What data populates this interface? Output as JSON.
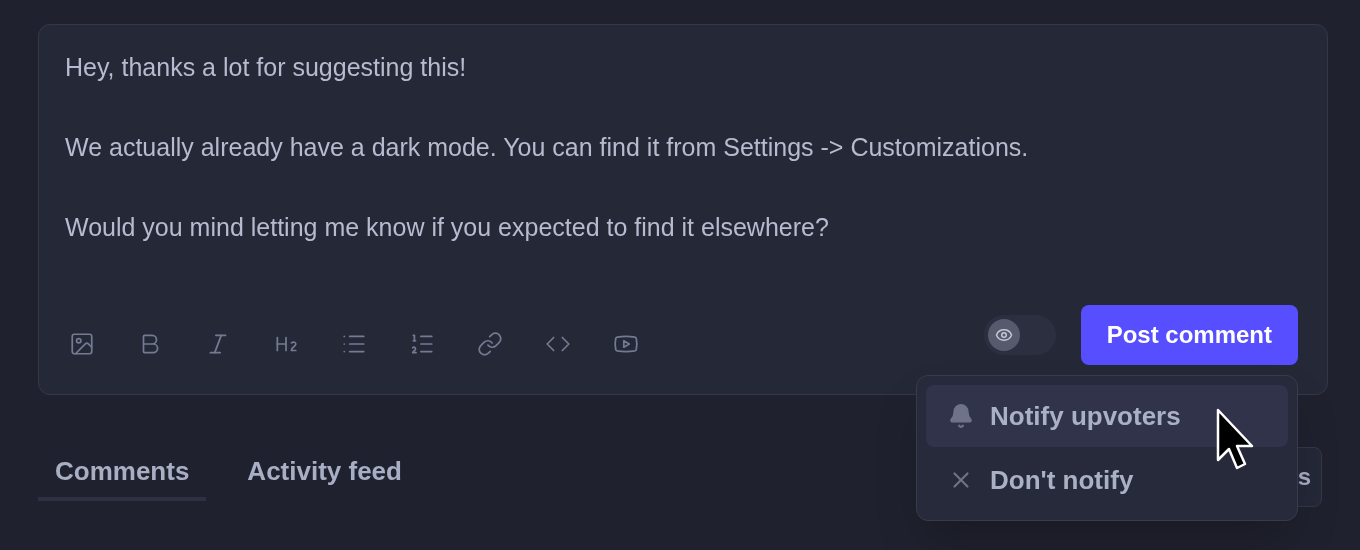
{
  "editor": {
    "paragraphs": [
      "Hey, thanks a lot for suggesting this!",
      "We actually already have a dark mode. You can find it from Settings -> Customizations.",
      "Would you mind letting me know if you expected to find it elsewhere?"
    ],
    "toolbar": [
      {
        "kind": "image"
      },
      {
        "kind": "bold"
      },
      {
        "kind": "italic"
      },
      {
        "kind": "heading"
      },
      {
        "kind": "bullets"
      },
      {
        "kind": "numbers"
      },
      {
        "kind": "link"
      },
      {
        "kind": "code"
      },
      {
        "kind": "video"
      }
    ],
    "private_toggle": {
      "on": false
    },
    "submit": "Post comment"
  },
  "notify_menu": [
    {
      "kind": "notify",
      "label": "Notify upvoters",
      "selected": true
    },
    {
      "kind": "dismiss",
      "label": "Don't notify",
      "selected": false
    }
  ],
  "tabs": [
    {
      "label": "Comments",
      "selected": true
    },
    {
      "label": "Activity feed",
      "selected": false
    }
  ],
  "hidden_button": "s"
}
